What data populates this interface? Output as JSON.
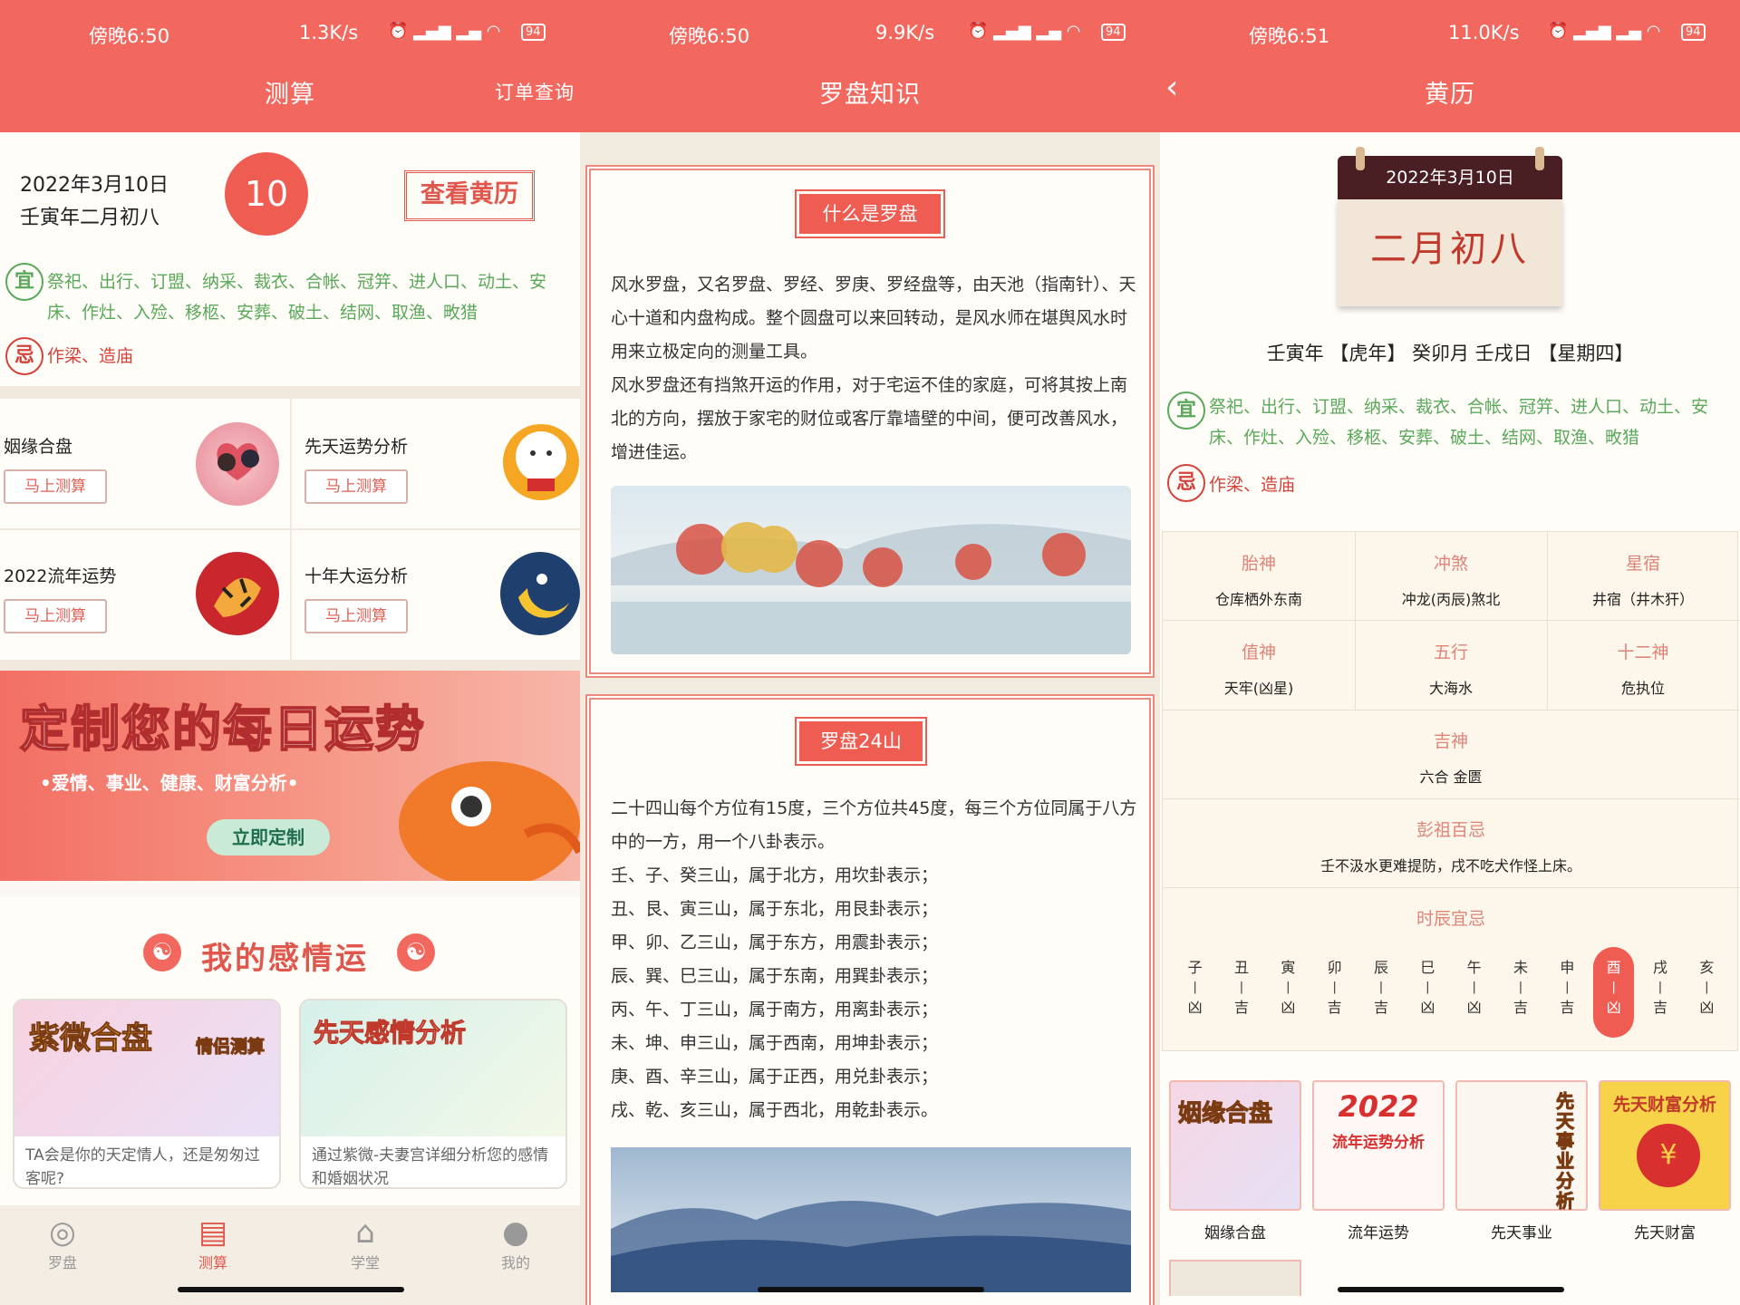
{
  "s1": {
    "time": "傍晚6:50",
    "speed": "1.3K/s",
    "battery": "94",
    "title": "测算",
    "order": "订单查询",
    "date": "2022年3月10日",
    "lunar": "壬寅年二月初八",
    "day": "10",
    "hl_btn": "查看黄历",
    "yi": "宜",
    "yi_text": "祭祀、出行、订盟、纳采、裁衣、合帐、冠笄、进人口、动土、安床、作灶、入殓、移柩、安葬、破土、结网、取渔、畋猎",
    "ji": "忌",
    "ji_text": "作梁、造庙",
    "cards": [
      {
        "title": "姻缘合盘",
        "btn": "马上测算"
      },
      {
        "title": "先天运势分析",
        "btn": "马上测算"
      },
      {
        "title": "2022流年运势",
        "btn": "马上测算"
      },
      {
        "title": "十年大运分析",
        "btn": "马上测算"
      }
    ],
    "banner": {
      "title": "定制您的每日运势",
      "sub": "•爱情、事业、健康、财富分析•",
      "btn": "立即定制"
    },
    "love_title": "我的感情运",
    "love": [
      {
        "art": "紫微合盘",
        "tag": "情侣测算",
        "desc": "TA会是你的天定情人，还是匆匆过客呢?"
      },
      {
        "art": "先天感情分析",
        "desc": "通过紫微-夫妻宫详细分析您的感情和婚姻状况"
      }
    ],
    "tabs": [
      "罗盘",
      "测算",
      "学堂",
      "我的"
    ]
  },
  "s2": {
    "time": "傍晚6:50",
    "speed": "9.9K/s",
    "battery": "94",
    "title": "罗盘知识",
    "sec1": {
      "title": "什么是罗盘",
      "p1": "风水罗盘，又名罗盘、罗经、罗庚、罗经盘等，由天池（指南针）、天心十道和内盘构成。整个圆盘可以来回转动，是风水师在堪舆风水时用来立极定向的测量工具。",
      "p2": "风水罗盘还有挡煞开运的作用，对于宅运不佳的家庭，可将其按上南北的方向，摆放于家宅的财位或客厅靠墙壁的中间，便可改善风水，增进佳运。"
    },
    "sec2": {
      "title": "罗盘24山",
      "lines": [
        "二十四山每个方位有15度，三个方位共45度，每三个方位同属于八方中的一方，用一个八卦表示。",
        "壬、子、癸三山，属于北方，用坎卦表示；",
        "丑、艮、寅三山，属于东北，用艮卦表示；",
        "甲、卯、乙三山，属于东方，用震卦表示；",
        "辰、巽、巳三山，属于东南，用巽卦表示；",
        "丙、午、丁三山，属于南方，用离卦表示；",
        "未、坤、申三山，属于西南，用坤卦表示；",
        "庚、酉、辛三山，属于正西，用兑卦表示；",
        "戌、乾、亥三山，属于西北，用乾卦表示。"
      ]
    }
  },
  "s3": {
    "time": "傍晚6:51",
    "speed": "11.0K/s",
    "battery": "94",
    "title": "黄历",
    "cal_date": "2022年3月10日",
    "cal_lunar": "二月初八",
    "ganzhi": "壬寅年 【虎年】 癸卯月 壬戌日 【星期四】",
    "yi": "宜",
    "yi_text": "祭祀、出行、订盟、纳采、裁衣、合帐、冠笄、进人口、动土、安床、作灶、入殓、移柩、安葬、破土、结网、取渔、畋猎",
    "ji": "忌",
    "ji_text": "作梁、造庙",
    "info": [
      {
        "k": "胎神",
        "v": "仓库栖外东南"
      },
      {
        "k": "冲煞",
        "v": "冲龙(丙辰)煞北"
      },
      {
        "k": "星宿",
        "v": "井宿（井木犴）"
      },
      {
        "k": "值神",
        "v": "天牢(凶星)"
      },
      {
        "k": "五行",
        "v": "大海水"
      },
      {
        "k": "十二神",
        "v": "危执位"
      }
    ],
    "jishen": {
      "k": "吉神",
      "v": "六合 金匮"
    },
    "pengzu": {
      "k": "彭祖百忌",
      "v": "壬不汲水更难提防，戌不吃犬作怪上床。"
    },
    "shichen_title": "时辰宜忌",
    "shichen": [
      {
        "z": "子",
        "r": "凶"
      },
      {
        "z": "丑",
        "r": "吉"
      },
      {
        "z": "寅",
        "r": "凶"
      },
      {
        "z": "卯",
        "r": "吉"
      },
      {
        "z": "辰",
        "r": "吉"
      },
      {
        "z": "巳",
        "r": "凶"
      },
      {
        "z": "午",
        "r": "凶"
      },
      {
        "z": "未",
        "r": "吉"
      },
      {
        "z": "申",
        "r": "吉"
      },
      {
        "z": "酉",
        "r": "凶"
      },
      {
        "z": "戌",
        "r": "吉"
      },
      {
        "z": "亥",
        "r": "凶"
      }
    ],
    "bottom": [
      {
        "art": "姻缘合盘",
        "label": "姻缘合盘"
      },
      {
        "art": "2022",
        "art2": "流年运势分析",
        "label": "流年运势"
      },
      {
        "art": "先天事业分析",
        "label": "先天事业"
      },
      {
        "art": "先天财富分析",
        "label": "先天财富"
      }
    ]
  },
  "colors": {
    "primary": "#f2685e",
    "accent_red": "#d3433b",
    "green": "#5aa85a",
    "bg": "#fbf7f2"
  },
  "icons": [
    "compass-icon",
    "search-doc-icon",
    "graduation-cap-icon",
    "user-icon",
    "back-arrow-icon",
    "wifi-icon",
    "battery-icon"
  ]
}
